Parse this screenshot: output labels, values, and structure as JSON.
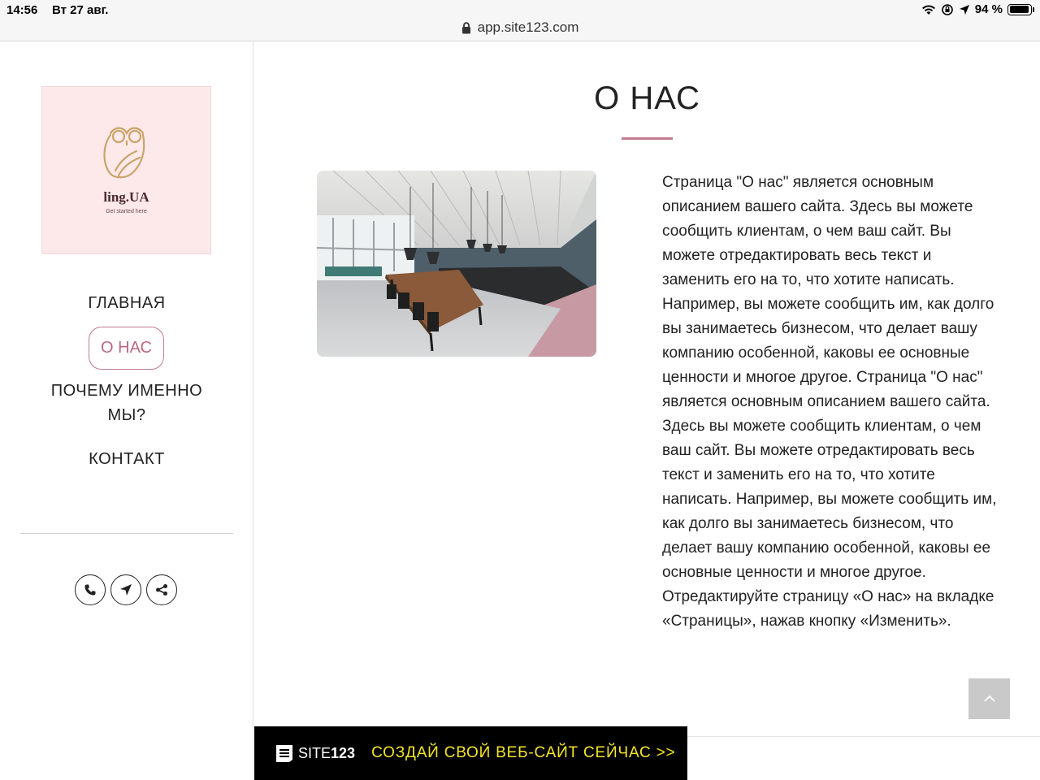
{
  "status_bar": {
    "time": "14:56",
    "date": "Вт 27 авг.",
    "battery": "94 %",
    "battery_level": 0.94
  },
  "browser": {
    "url": "app.site123.com",
    "lock_icon": "lock-icon"
  },
  "logo": {
    "name": "ling.UA",
    "tagline": "Get started here",
    "background": "#fde8ea",
    "icon": "owl-icon"
  },
  "nav": {
    "items": [
      {
        "label": "ГЛАВНАЯ"
      },
      {
        "label": "О НАС",
        "active": true
      },
      {
        "label_line1": "ПОЧЕМУ ИМЕННО",
        "label_line2": "МЫ?"
      },
      {
        "label": "КОНТАКТ"
      }
    ]
  },
  "social": [
    "phone-icon",
    "location-arrow-icon",
    "share-icon"
  ],
  "main": {
    "title": "О НАС",
    "accent_color": "#c27a8f",
    "text_lines": [
      "Страница \"О нас\" является основным",
      "описанием вашего сайта. Здесь вы можете",
      "сообщить клиентам, о чем ваш сайт. Вы",
      "можете отредактировать весь текст и",
      "заменить его на то, что хотите написать.",
      "Например, вы можете сообщить им, как долго",
      "вы занимаетесь бизнесом, что делает вашу",
      "компанию особенной, каковы ее основные",
      "ценности и многое другое. Страница \"О нас\"",
      "является основным описанием вашего сайта.",
      "Здесь вы можете сообщить клиентам, о чем",
      "ваш сайт. Вы можете отредактировать весь",
      "текст и заменить его на то, что хотите",
      "написать. Например, вы можете сообщить им,",
      "как долго вы занимаетесь бизнесом, что",
      "делает вашу компанию особенной, каковы ее",
      "основные ценности и многое другое.",
      "Отредактируйте страницу «О нас» на вкладке",
      "«Страницы», нажав кнопку «Изменить»."
    ]
  },
  "banner": {
    "brand_prefix": "SITE",
    "brand_suffix": "123",
    "cta": "СОЗДАЙ СВОЙ ВЕБ-САЙТ СЕЙЧАС >>",
    "cta_color": "#f5e52a"
  }
}
